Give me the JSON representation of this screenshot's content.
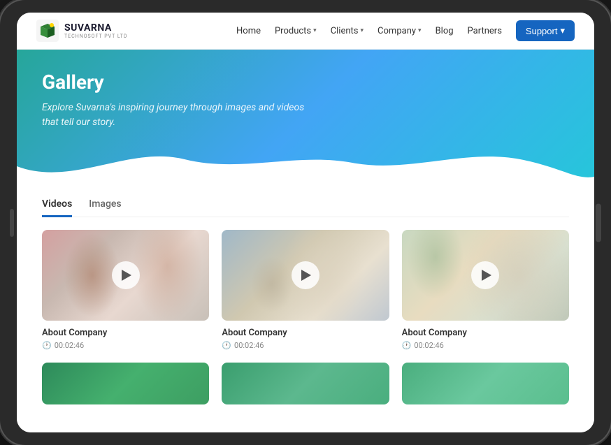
{
  "brand": {
    "name": "SUVARNA",
    "sub": "TECHNOSOFT PVT LTD"
  },
  "nav": {
    "links": [
      {
        "label": "Home",
        "has_dropdown": false
      },
      {
        "label": "Products",
        "has_dropdown": true
      },
      {
        "label": "Clients",
        "has_dropdown": true
      },
      {
        "label": "Company",
        "has_dropdown": true
      },
      {
        "label": "Blog",
        "has_dropdown": false
      },
      {
        "label": "Partners",
        "has_dropdown": false
      }
    ],
    "support_label": "Support"
  },
  "hero": {
    "title": "Gallery",
    "subtitle": "Explore Suvarna's inspiring journey through images and videos that tell our story."
  },
  "tabs": [
    {
      "label": "Videos",
      "active": true
    },
    {
      "label": "Images",
      "active": false
    }
  ],
  "videos": [
    {
      "title": "About Company",
      "duration": "00:02:46"
    },
    {
      "title": "About Company",
      "duration": "00:02:46"
    },
    {
      "title": "About Company",
      "duration": "00:02:46"
    }
  ]
}
